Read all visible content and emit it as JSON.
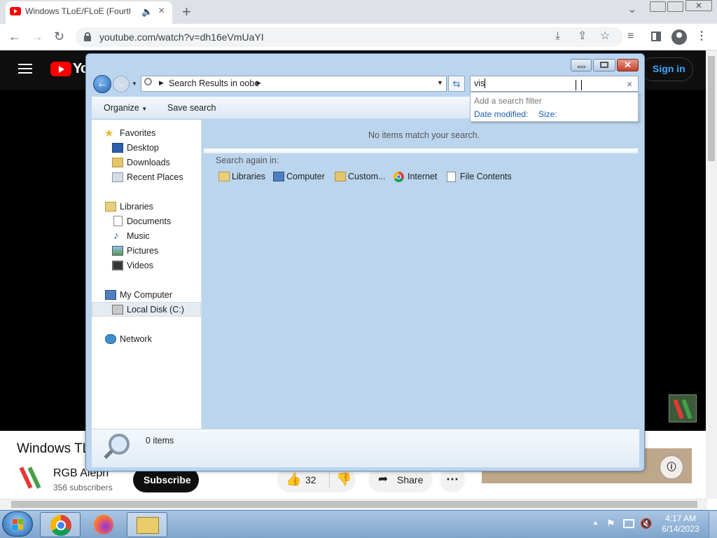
{
  "browser": {
    "tab_title": "Windows TLoE/FLoE (Fourth",
    "url": "youtube.com/watch?v=dh16eVmUaYI",
    "new_tab": "+",
    "dropdown": "⌄"
  },
  "youtube": {
    "sign_in": "Sign in",
    "video_title": "Windows TL",
    "channel_name": "RGB Aleph",
    "subscribers": "356 subscribers",
    "subscribe": "Subscribe",
    "likes": "32",
    "share": "Share",
    "more": "⋯",
    "logo_text": "Yo"
  },
  "explorer": {
    "breadcrumb_folder": "Search Results in oobe",
    "search_value": "vis",
    "search_clear": "×",
    "filter_heading": "Add a search filter",
    "filter_date": "Date modified:",
    "filter_size": "Size:",
    "organize": "Organize",
    "save_search": "Save search",
    "no_items": "No items match your search.",
    "search_again": "Search again in:",
    "search_again_items": [
      "Libraries",
      "Computer",
      "Custom...",
      "Internet",
      "File Contents"
    ],
    "status": "0 items",
    "nav": {
      "favorites": "Favorites",
      "desktop": "Desktop",
      "downloads": "Downloads",
      "recent": "Recent Places",
      "libraries": "Libraries",
      "documents": "Documents",
      "music": "Music",
      "pictures": "Pictures",
      "videos": "Videos",
      "computer": "My Computer",
      "local_disk": "Local Disk (C:)",
      "network": "Network"
    }
  },
  "taskbar": {
    "time": "4:17 AM",
    "date": "6/14/2023"
  }
}
